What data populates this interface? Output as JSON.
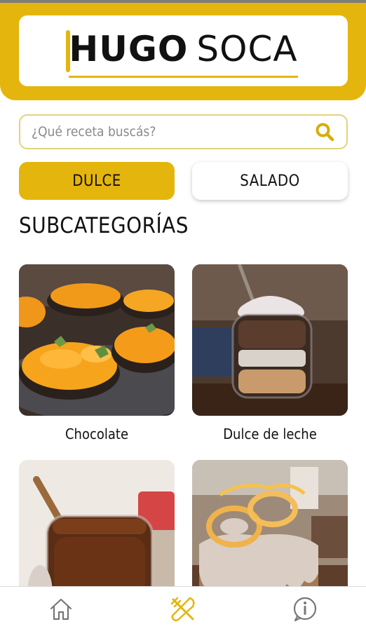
{
  "brand": {
    "logo_part1": "HUGO",
    "logo_part2": "SOCA",
    "accent_color": "#e4b50c"
  },
  "search": {
    "placeholder": "¿Qué receta buscás?",
    "value": "",
    "icon": "search-icon"
  },
  "category_toggle": {
    "options": [
      {
        "label": "DULCE",
        "selected": true
      },
      {
        "label": "SALADO",
        "selected": false
      }
    ]
  },
  "section": {
    "title": "SUBCATEGORÍAS"
  },
  "subcategories": [
    {
      "label": "Chocolate",
      "image": "orange-tartlets-photo"
    },
    {
      "label": "Dulce de leche",
      "image": "layered-dessert-jar-photo"
    },
    {
      "label": "",
      "image": "jam-jar-with-spoon-photo"
    },
    {
      "label": "",
      "image": "glazed-cake-with-orange-slices-photo"
    }
  ],
  "bottom_nav": {
    "items": [
      {
        "icon": "home-icon",
        "active": false
      },
      {
        "icon": "utensils-icon",
        "active": true
      },
      {
        "icon": "info-icon",
        "active": false
      }
    ]
  }
}
